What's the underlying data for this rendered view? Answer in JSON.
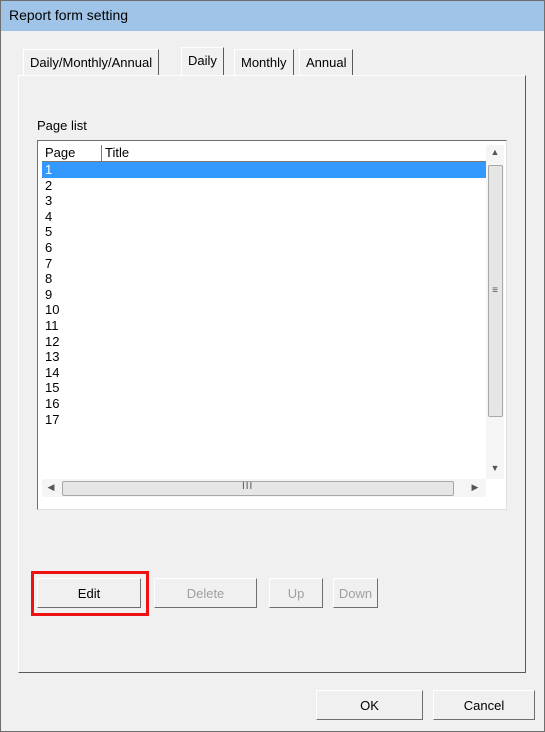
{
  "window": {
    "title": "Report form setting"
  },
  "tabs": [
    {
      "label": "Daily/Monthly/Annual",
      "active": false
    },
    {
      "label": "Daily",
      "active": true
    },
    {
      "label": "Monthly",
      "active": false
    },
    {
      "label": "Annual",
      "active": false
    }
  ],
  "page_list": {
    "label": "Page list",
    "columns": {
      "page": "Page",
      "title": "Title"
    },
    "rows": [
      "1",
      "2",
      "3",
      "4",
      "5",
      "6",
      "7",
      "8",
      "9",
      "10",
      "11",
      "12",
      "13",
      "14",
      "15",
      "16",
      "17"
    ],
    "selected_row": "1",
    "scroll_grip": "III"
  },
  "buttons": {
    "edit": "Edit",
    "delete": "Delete",
    "up": "Up",
    "down": "Down",
    "ok": "OK",
    "cancel": "Cancel"
  },
  "icons": {
    "scroll_up": "up-arrow-icon",
    "scroll_down": "down-arrow-icon",
    "scroll_left": "left-arrow-icon",
    "scroll_right": "right-arrow-icon"
  },
  "colors": {
    "selection": "#3399ff",
    "highlight_box": "#ee1111",
    "titlebar": "#9fc4e7"
  }
}
